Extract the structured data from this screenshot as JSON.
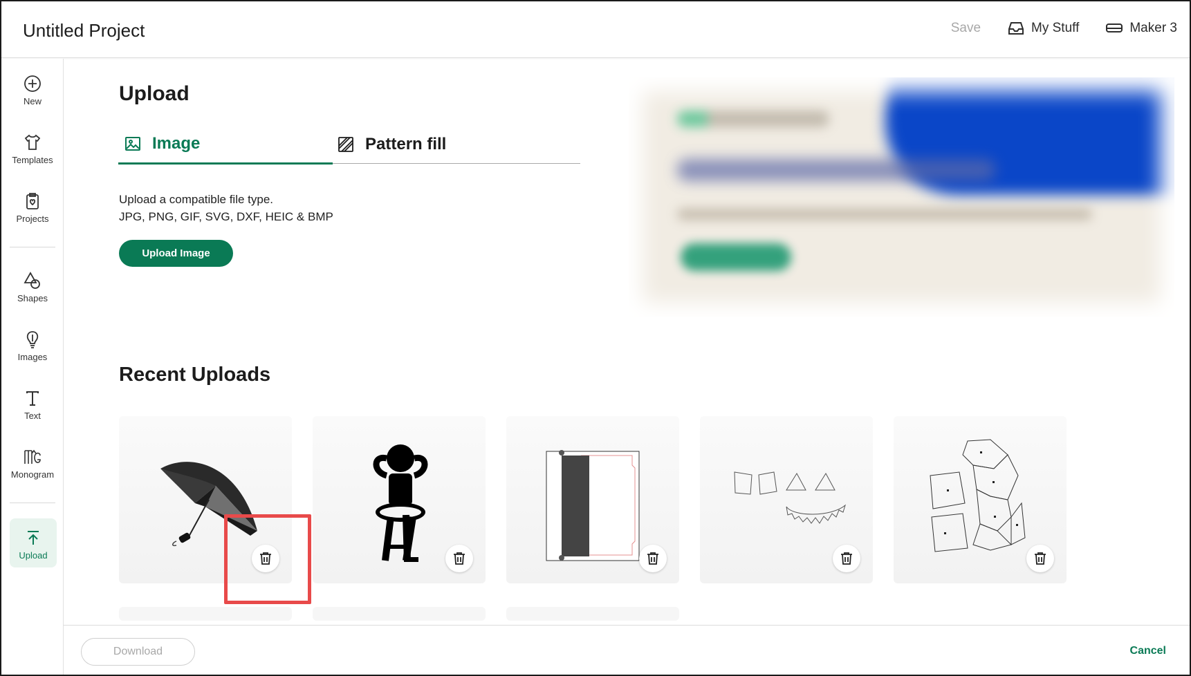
{
  "header": {
    "title": "Untitled Project",
    "save_label": "Save",
    "my_stuff_label": "My Stuff",
    "machine_label": "Maker 3"
  },
  "sidebar": {
    "items": [
      {
        "label": "New",
        "icon": "plus-circle-icon"
      },
      {
        "label": "Templates",
        "icon": "shirt-icon"
      },
      {
        "label": "Projects",
        "icon": "projects-icon"
      },
      {
        "label": "Shapes",
        "icon": "shapes-icon"
      },
      {
        "label": "Images",
        "icon": "lightbulb-icon"
      },
      {
        "label": "Text",
        "icon": "text-icon"
      },
      {
        "label": "Monogram",
        "icon": "monogram-icon"
      },
      {
        "label": "Upload",
        "icon": "upload-icon"
      }
    ],
    "active": "Upload"
  },
  "upload": {
    "title": "Upload",
    "tabs": [
      {
        "label": "Image",
        "icon": "image-icon",
        "selected": true
      },
      {
        "label": "Pattern fill",
        "icon": "pattern-fill-icon",
        "selected": false
      }
    ],
    "hint_line1": "Upload a compatible file type.",
    "hint_line2": "JPG, PNG, GIF, SVG, DXF, HEIC & BMP",
    "upload_button": "Upload Image"
  },
  "recent": {
    "title": "Recent Uploads",
    "items": [
      {
        "thumbnail": "umbrella",
        "delete_icon": "trash-icon"
      },
      {
        "thumbnail": "person-sitting-on-stool",
        "delete_icon": "trash-icon"
      },
      {
        "thumbnail": "card-template",
        "delete_icon": "trash-icon"
      },
      {
        "thumbnail": "pumpkin-face",
        "delete_icon": "trash-icon"
      },
      {
        "thumbnail": "papercraft-pieces",
        "delete_icon": "trash-icon"
      }
    ]
  },
  "footer": {
    "download_label": "Download",
    "cancel_label": "Cancel"
  },
  "colors": {
    "accent": "#0a7a55",
    "highlight": "#e84a4a",
    "banner_blue": "#0a46c8"
  }
}
